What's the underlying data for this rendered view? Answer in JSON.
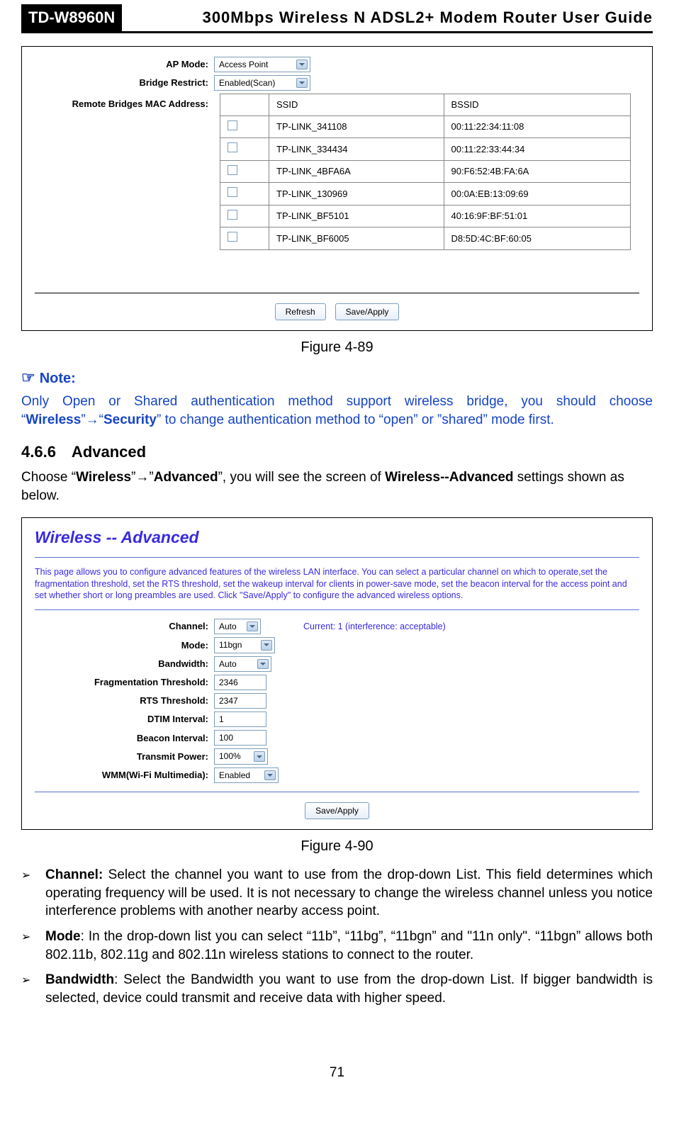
{
  "header": {
    "badge": "TD-W8960N",
    "title": "300Mbps Wireless N ADSL2+ Modem Router User Guide"
  },
  "figure1": {
    "labels": {
      "ap_mode": "AP Mode:",
      "bridge_restrict": "Bridge Restrict:",
      "remote_mac": "Remote Bridges MAC Address:"
    },
    "values": {
      "ap_mode": "Access Point",
      "bridge_restrict": "Enabled(Scan)"
    },
    "table": {
      "headers": {
        "blank": "",
        "ssid": "SSID",
        "bssid": "BSSID"
      },
      "rows": [
        {
          "ssid": "TP-LINK_341108",
          "bssid": "00:11:22:34:11:08"
        },
        {
          "ssid": "TP-LINK_334434",
          "bssid": "00:11:22:33:44:34"
        },
        {
          "ssid": "TP-LINK_4BFA6A",
          "bssid": "90:F6:52:4B:FA:6A"
        },
        {
          "ssid": "TP-LINK_130969",
          "bssid": "00:0A:EB:13:09:69"
        },
        {
          "ssid": "TP-LINK_BF5101",
          "bssid": "40:16:9F:BF:51:01"
        },
        {
          "ssid": "TP-LINK_BF6005",
          "bssid": "D8:5D:4C:BF:60:05"
        }
      ]
    },
    "buttons": {
      "refresh": "Refresh",
      "save": "Save/Apply"
    },
    "caption": "Figure 4-89"
  },
  "note": {
    "icon": "☞",
    "label": "Note:",
    "text_pre": "Only Open or Shared authentication method support wireless bridge, you should choose “",
    "wireless": "Wireless",
    "arrow": "”→“",
    "security": "Security",
    "text_post": "” to change authentication method to “open” or ”shared” mode first."
  },
  "section": {
    "num_title": "4.6.6 Advanced",
    "para_pre": "Choose “",
    "wireless": "Wireless",
    "mid": "”→”",
    "advanced": "Advanced",
    "mid2": "”, you will see the screen of ",
    "scr": "Wireless--Advanced",
    "tail": " settings shown as below."
  },
  "figure2": {
    "title": "Wireless -- Advanced",
    "desc": "This page allows you to configure advanced features of the wireless LAN interface. You can select a particular channel on which to operate,set the fragmentation threshold, set the RTS threshold, set the wakeup interval for clients in power-save mode, set the beacon interval for the access point and set whether short or long preambles are used. Click \"Save/Apply\" to configure the advanced wireless options.",
    "labels": {
      "channel": "Channel:",
      "mode": "Mode:",
      "bandwidth": "Bandwidth:",
      "frag": "Fragmentation Threshold:",
      "rts": "RTS Threshold:",
      "dtim": "DTIM Interval:",
      "beacon": "Beacon Interval:",
      "tx": "Transmit Power:",
      "wmm": "WMM(Wi-Fi Multimedia):"
    },
    "values": {
      "channel": "Auto",
      "mode": "11bgn",
      "bandwidth": "Auto",
      "frag": "2346",
      "rts": "2347",
      "dtim": "1",
      "beacon": "100",
      "tx": "100%",
      "wmm": "Enabled"
    },
    "status": "Current: 1 (interference: acceptable)",
    "button": "Save/Apply",
    "caption": "Figure 4-90"
  },
  "bullets": {
    "b1": {
      "lead": "Channel:",
      "text": " Select the channel you want to use from the drop-down List. This field determines which operating frequency will be used. It is not necessary to change the wireless channel unless you notice interference problems with another nearby access point."
    },
    "b2": {
      "lead": "Mode",
      "text": ": In the drop-down list you can select “11b”, “11bg”, “11bgn” and \"11n only\". “11bgn” allows both 802.11b, 802.11g and 802.11n wireless stations to connect to the router."
    },
    "b3": {
      "lead": "Bandwidth",
      "text": ": Select the Bandwidth you want to use from the drop-down List. If bigger bandwidth is selected, device could transmit and receive data with higher speed."
    }
  },
  "page_number": "71"
}
